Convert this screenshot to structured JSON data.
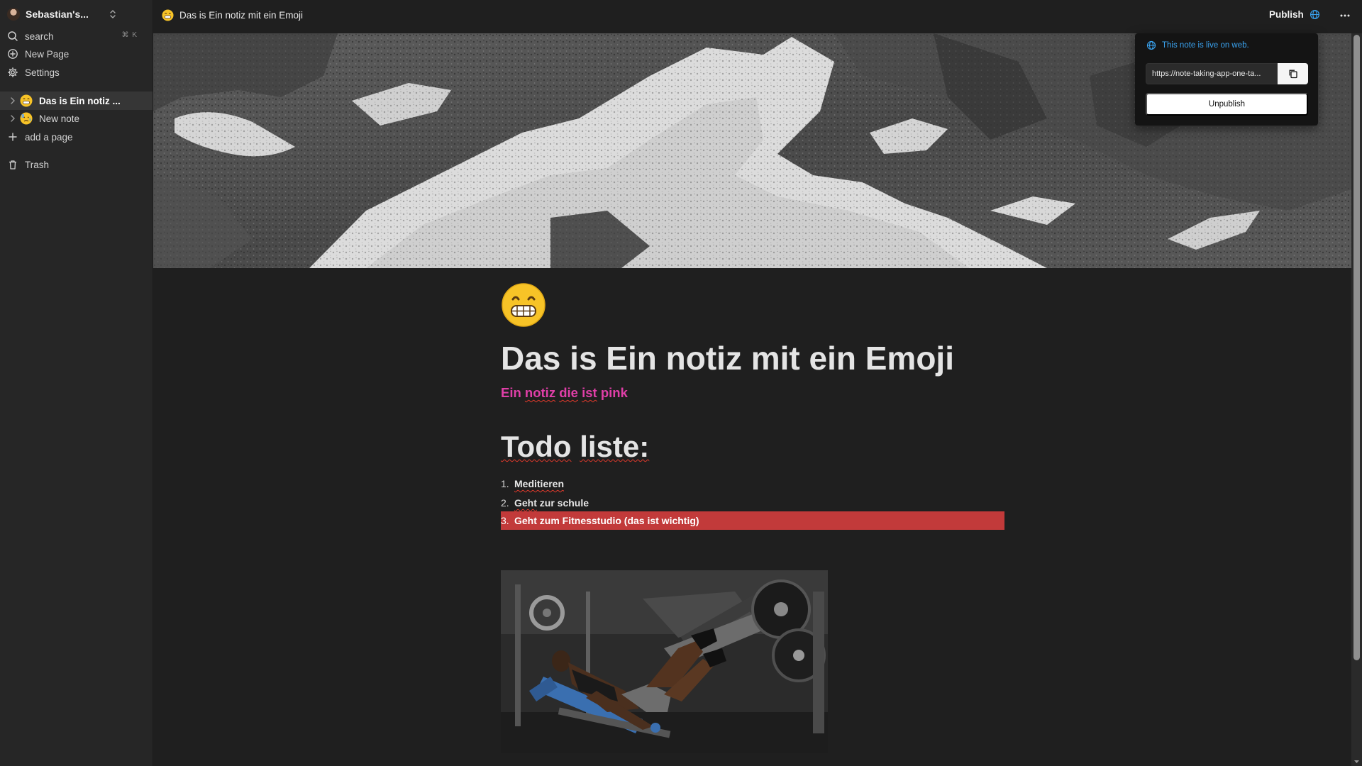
{
  "sidebar": {
    "workspace_name": "Sebastian's...",
    "search_label": "search",
    "search_shortcut": "⌘ K",
    "new_page_label": "New Page",
    "settings_label": "Settings",
    "pages": [
      {
        "label": "Das is Ein notiz ...",
        "icon": "grinning-face-emoji",
        "active": true
      },
      {
        "label": "New note",
        "icon": "anxious-face-emoji",
        "active": false
      }
    ],
    "add_page_label": "add a page",
    "trash_label": "Trash"
  },
  "topbar": {
    "breadcrumb_title": "Das is Ein notiz mit ein Emoji",
    "publish_label": "Publish"
  },
  "publish_popover": {
    "live_text": "This note is live on web.",
    "url_value": "https://note-taking-app-one-ta...",
    "unpublish_label": "Unpublish"
  },
  "document": {
    "icon": "grinning-face-emoji",
    "title": "Das is Ein notiz mit ein Emoji",
    "pink_text": {
      "w1": "Ein",
      "w2": "notiz",
      "w3": "die",
      "w4": "ist",
      "w5": "pink"
    },
    "heading": {
      "w1": "Todo",
      "w2": "liste:"
    },
    "todo_items": [
      {
        "num": "1.",
        "text": "Meditieren"
      },
      {
        "num": "2.",
        "text_w1": "Geht",
        "text_w2": "zur",
        "text_w3": "schule"
      },
      {
        "num": "3.",
        "text": "Geht zum Fitnesstudio (das ist wichtig)",
        "highlighted": true
      }
    ]
  },
  "colors": {
    "background": "#1f1f1f",
    "sidebar": "#262626",
    "accent_pink": "#e03fa8",
    "highlight_red": "#c23a3a",
    "live_blue": "#3aa3f0"
  }
}
